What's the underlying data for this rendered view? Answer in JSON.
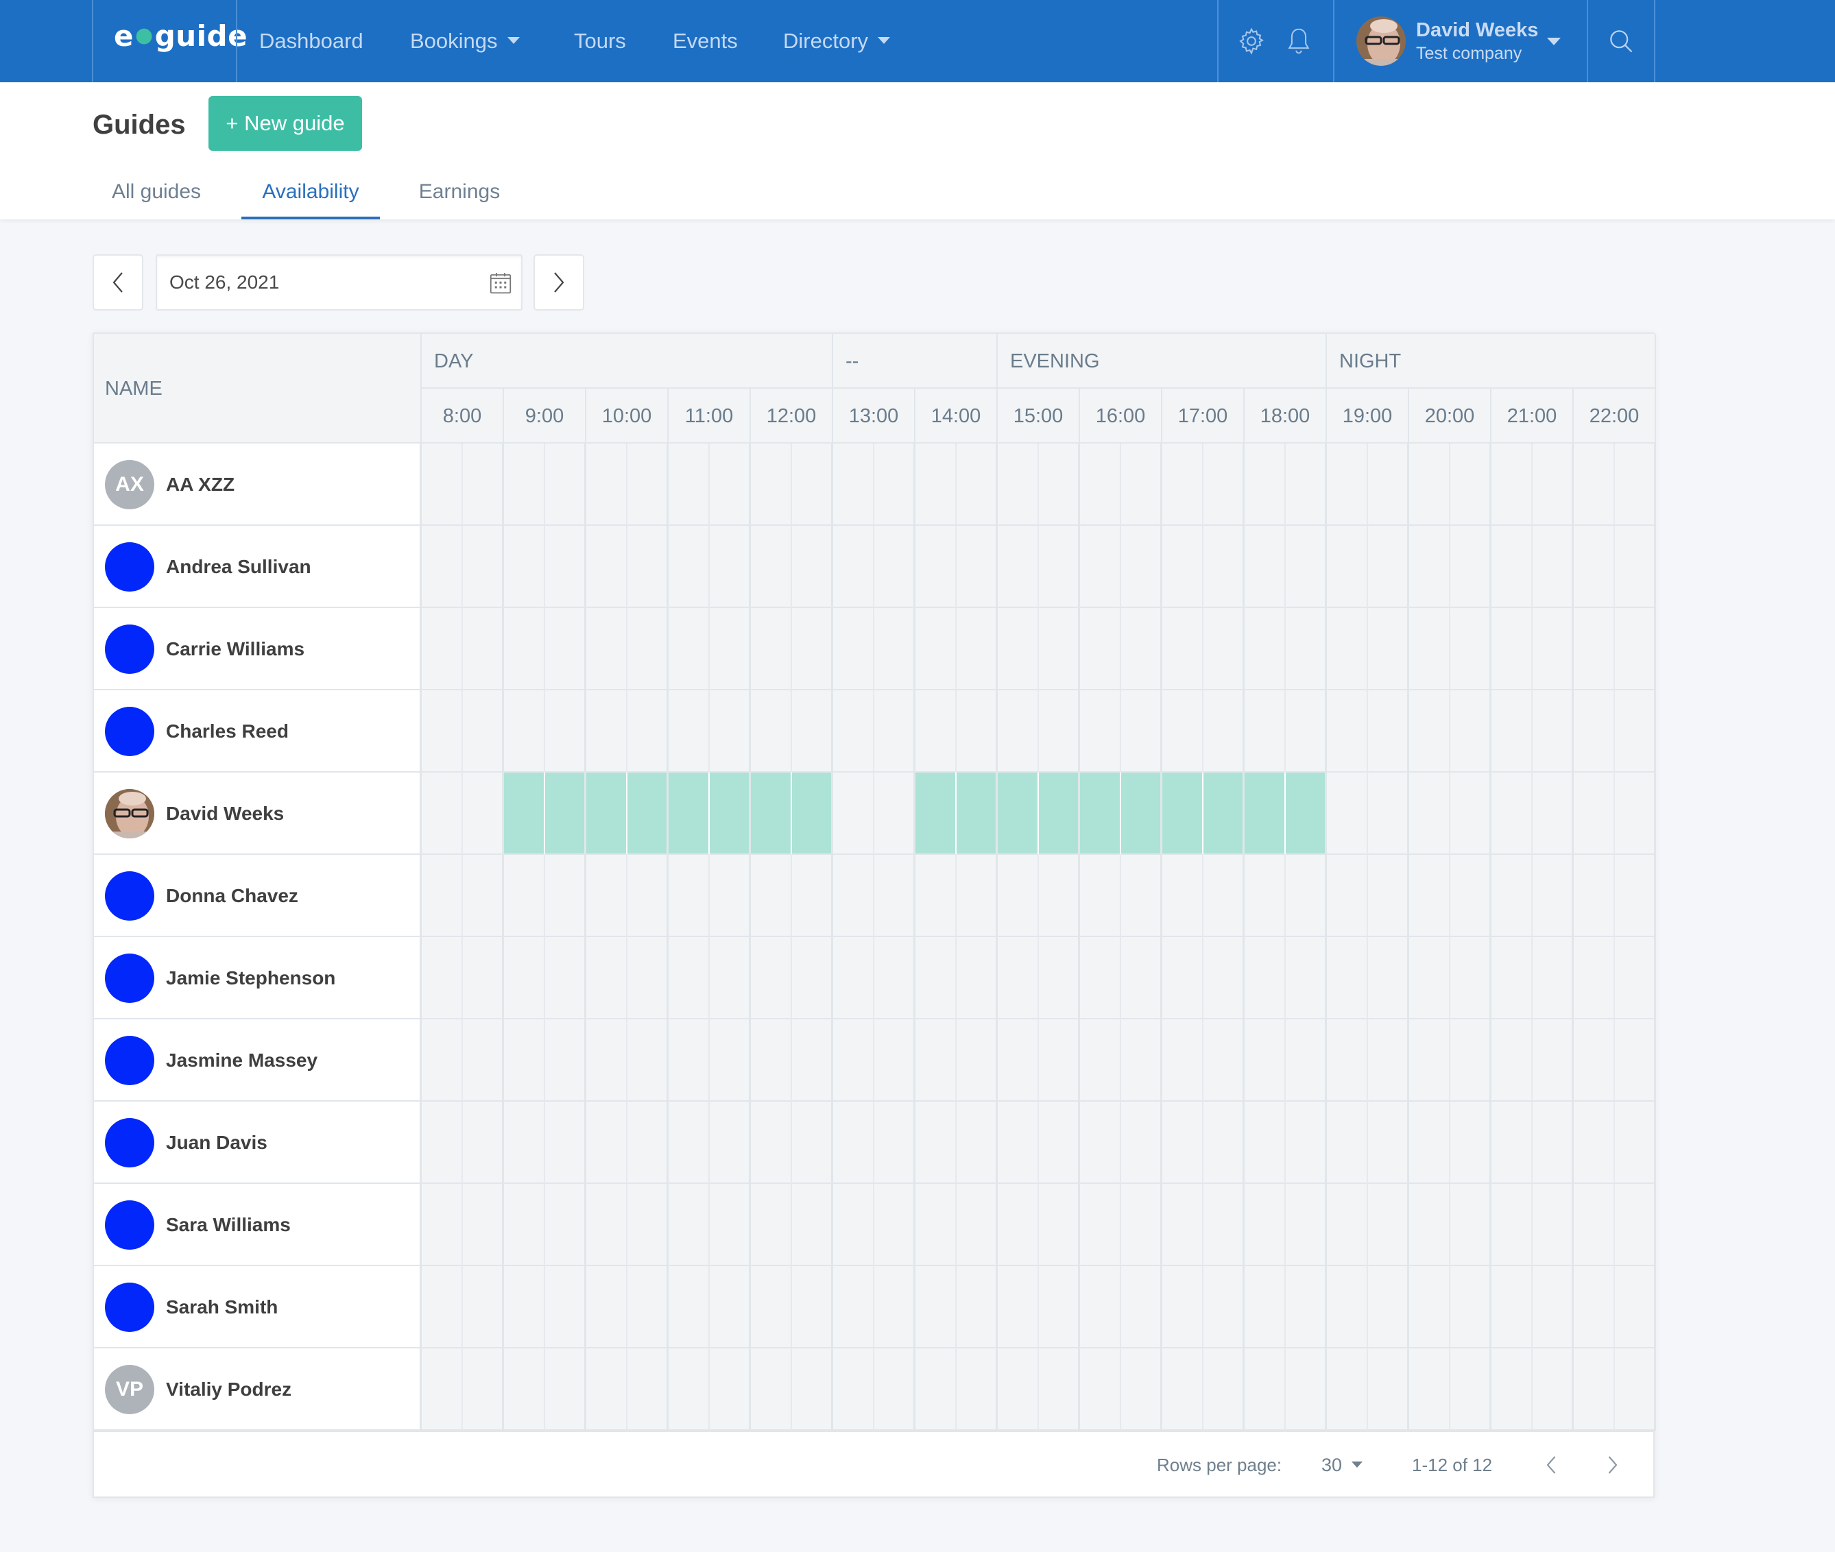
{
  "topbar": {
    "logo_left": "e",
    "logo_right": "guide",
    "nav": [
      {
        "label": "Dashboard",
        "has_dropdown": false
      },
      {
        "label": "Bookings",
        "has_dropdown": true
      },
      {
        "label": "Tours",
        "has_dropdown": false
      },
      {
        "label": "Events",
        "has_dropdown": false
      },
      {
        "label": "Directory",
        "has_dropdown": true
      }
    ],
    "icons": [
      "gear-icon",
      "bell-icon",
      "search-icon"
    ],
    "user": {
      "name": "David Weeks",
      "company": "Test company"
    }
  },
  "page": {
    "title": "Guides",
    "new_button": "+ New guide",
    "tabs": [
      {
        "label": "All guides",
        "active": false
      },
      {
        "label": "Availability",
        "active": true
      },
      {
        "label": "Earnings",
        "active": false
      }
    ]
  },
  "date_picker": {
    "value": "Oct 26, 2021"
  },
  "table": {
    "name_header": "NAME",
    "periods": [
      {
        "label": "DAY",
        "hours": 5
      },
      {
        "label": "--",
        "hours": 2
      },
      {
        "label": "EVENING",
        "hours": 4
      },
      {
        "label": "NIGHT",
        "hours": 4
      }
    ],
    "hours": [
      "8:00",
      "9:00",
      "10:00",
      "11:00",
      "12:00",
      "13:00",
      "14:00",
      "15:00",
      "16:00",
      "17:00",
      "18:00",
      "19:00",
      "20:00",
      "21:00",
      "22:00"
    ],
    "available_color": "#ade3d7",
    "rows": [
      {
        "name": "AA XZZ",
        "avatar": {
          "type": "initials",
          "text": "AX",
          "color": "#adb3b9"
        },
        "available": []
      },
      {
        "name": "Andrea Sullivan",
        "avatar": {
          "type": "color",
          "text": "",
          "color": "#0227fb"
        },
        "available": []
      },
      {
        "name": "Carrie Williams",
        "avatar": {
          "type": "color",
          "text": "",
          "color": "#0227fb"
        },
        "available": []
      },
      {
        "name": "Charles Reed",
        "avatar": {
          "type": "color",
          "text": "",
          "color": "#0227fb"
        },
        "available": []
      },
      {
        "name": "David Weeks",
        "avatar": {
          "type": "photo",
          "text": "",
          "color": "#8a6a4e"
        },
        "available": [
          [
            "9:00",
            "13:00"
          ],
          [
            "14:00",
            "19:00"
          ]
        ]
      },
      {
        "name": "Donna Chavez",
        "avatar": {
          "type": "color",
          "text": "",
          "color": "#0227fb"
        },
        "available": []
      },
      {
        "name": "Jamie Stephenson",
        "avatar": {
          "type": "color",
          "text": "",
          "color": "#0227fb"
        },
        "available": []
      },
      {
        "name": "Jasmine Massey",
        "avatar": {
          "type": "color",
          "text": "",
          "color": "#0227fb"
        },
        "available": []
      },
      {
        "name": "Juan Davis",
        "avatar": {
          "type": "color",
          "text": "",
          "color": "#0227fb"
        },
        "available": []
      },
      {
        "name": "Sara Williams",
        "avatar": {
          "type": "color",
          "text": "",
          "color": "#0227fb"
        },
        "available": []
      },
      {
        "name": "Sarah Smith",
        "avatar": {
          "type": "color",
          "text": "",
          "color": "#0227fb"
        },
        "available": []
      },
      {
        "name": "Vitaliy Podrez",
        "avatar": {
          "type": "initials",
          "text": "VP",
          "color": "#adb3b9"
        },
        "available": []
      }
    ]
  },
  "pagination": {
    "rows_per_page_label": "Rows per page:",
    "rows_per_page": "30",
    "range": "1-12 of 12"
  }
}
